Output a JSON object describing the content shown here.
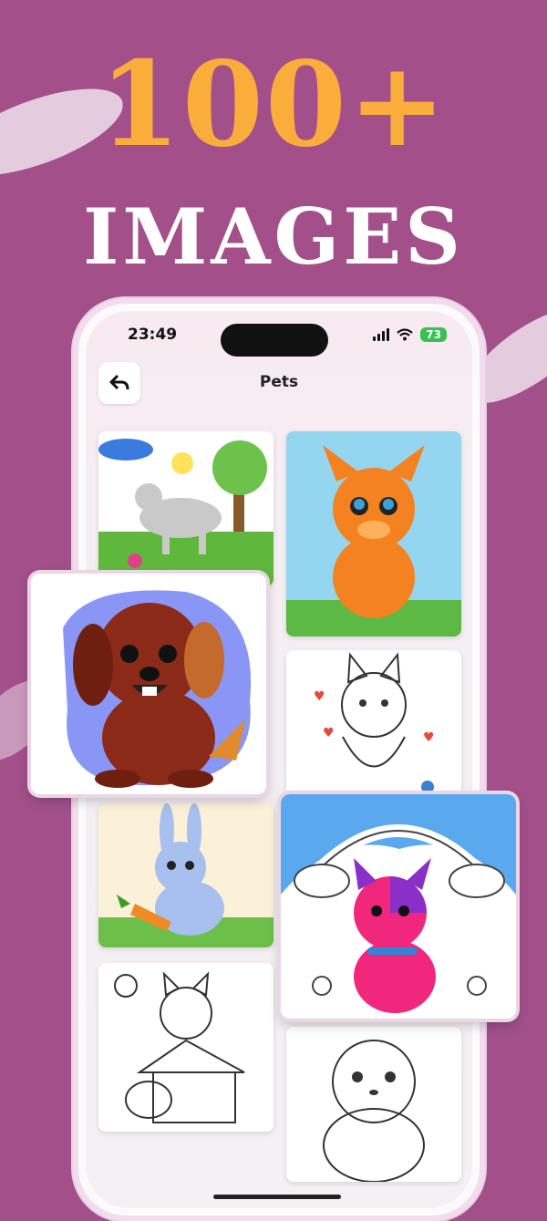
{
  "promo": {
    "count": "100+",
    "label": "IMAGES"
  },
  "status_bar": {
    "time": "23:49",
    "battery": "73"
  },
  "nav": {
    "title": "Pets",
    "back_icon": "back-arrow-icon"
  },
  "colors": {
    "background": "#a24f8a",
    "accent": "#fbad3c",
    "battery": "#36c152"
  },
  "gallery": {
    "items": [
      {
        "name": "wolf-in-park",
        "colored": true
      },
      {
        "name": "orange-kitten",
        "colored": true
      },
      {
        "name": "smiling-puppy",
        "colored": true
      },
      {
        "name": "cat-with-hearts",
        "colored": false
      },
      {
        "name": "bunny-with-carrots",
        "colored": true
      },
      {
        "name": "rainbow-cat",
        "colored": true
      },
      {
        "name": "cat-on-doghouse",
        "colored": false
      },
      {
        "name": "hamster",
        "colored": false
      }
    ]
  }
}
